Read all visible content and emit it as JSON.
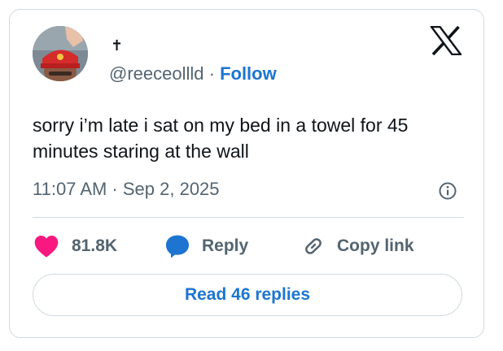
{
  "author": {
    "display_name": "✝",
    "handle": "@reeceollld",
    "separator": " · ",
    "follow_label": "Follow"
  },
  "tweet": {
    "text": "sorry i’m late i sat on my bed in a towel for 45 minutes staring at the wall",
    "timestamp": "11:07 AM · Sep 2, 2025"
  },
  "actions": {
    "likes": "81.8K",
    "reply_label": "Reply",
    "copy_link_label": "Copy link"
  },
  "footer": {
    "read_replies_label": "Read 46 replies"
  },
  "colors": {
    "accent": "#1d75d1",
    "like": "#f91880",
    "muted": "#536471",
    "border": "#cfd9de"
  },
  "icons": [
    "x-logo-icon",
    "info-icon",
    "heart-icon",
    "reply-bubble-icon",
    "link-icon"
  ]
}
